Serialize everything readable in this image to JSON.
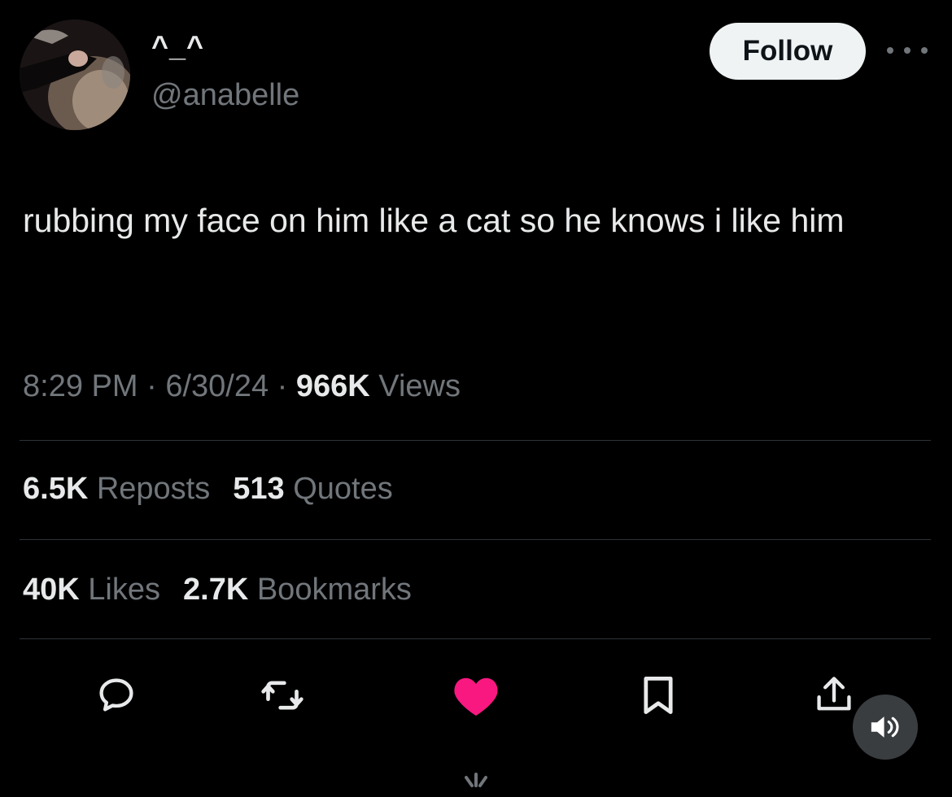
{
  "author": {
    "display_name": "^_^",
    "handle": "@anabelle",
    "avatar_icon": "profile-photo"
  },
  "follow_label": "Follow",
  "tweet": {
    "text": "rubbing my face on him like a cat so he knows i like him"
  },
  "meta": {
    "time": "8:29 PM",
    "sep1": " · ",
    "date": "6/30/24",
    "sep2": " · ",
    "views_count": "966K",
    "views_label": " Views"
  },
  "stats": {
    "reposts_count": "6.5K",
    "reposts_label": " Reposts",
    "quotes_count": "513",
    "quotes_label": " Quotes",
    "likes_count": "40K",
    "likes_label": " Likes",
    "bookmarks_count": "2.7K",
    "bookmarks_label": " Bookmarks"
  },
  "actions": {
    "reply_icon": "reply-icon",
    "repost_icon": "repost-icon",
    "like_icon": "heart-icon",
    "bookmark_icon": "bookmark-icon",
    "share_icon": "share-icon"
  },
  "colors": {
    "background": "#000000",
    "text": "#e7e9ea",
    "secondary": "#71767b",
    "like": "#f91880",
    "follow_bg": "#eff3f4"
  }
}
